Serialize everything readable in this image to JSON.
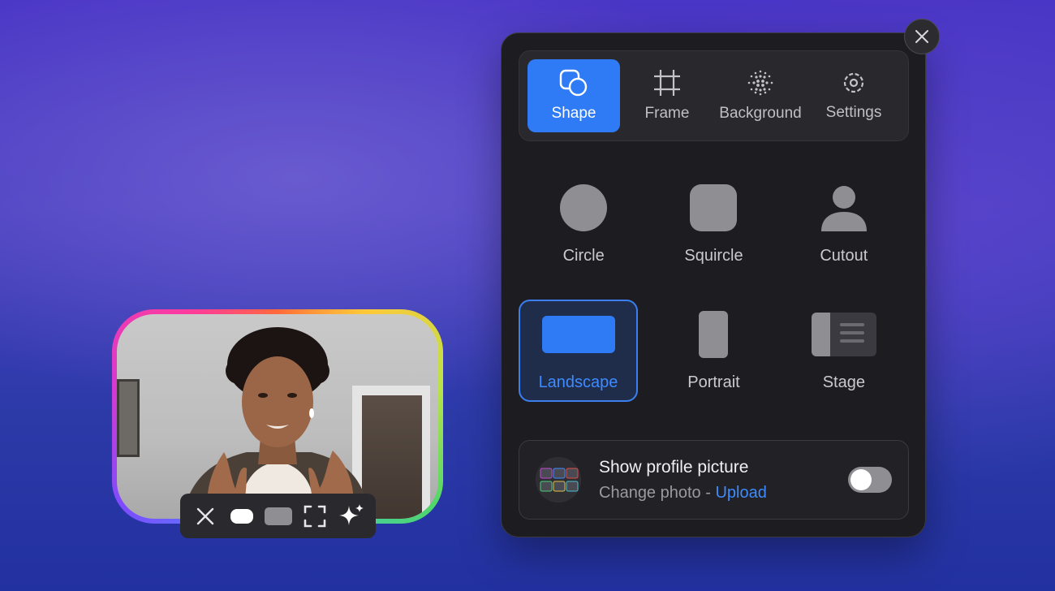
{
  "camera": {
    "toolbar": [
      {
        "name": "close-icon"
      },
      {
        "name": "pill-shape-icon"
      },
      {
        "name": "rectangle-shape-icon"
      },
      {
        "name": "fullscreen-icon"
      },
      {
        "name": "sparkle-icon"
      }
    ]
  },
  "panel": {
    "tabs": [
      {
        "label": "Shape",
        "icon": "shape-icon",
        "active": true
      },
      {
        "label": "Frame",
        "icon": "frame-icon",
        "active": false
      },
      {
        "label": "Background",
        "icon": "background-icon",
        "active": false
      },
      {
        "label": "Settings",
        "icon": "gear-icon",
        "active": false
      }
    ],
    "shapes": [
      {
        "label": "Circle",
        "icon": "circle-icon",
        "selected": false
      },
      {
        "label": "Squircle",
        "icon": "squircle-icon",
        "selected": false
      },
      {
        "label": "Cutout",
        "icon": "cutout-icon",
        "selected": false
      },
      {
        "label": "Landscape",
        "icon": "landscape-icon",
        "selected": true
      },
      {
        "label": "Portrait",
        "icon": "portrait-icon",
        "selected": false
      },
      {
        "label": "Stage",
        "icon": "stage-icon",
        "selected": false
      }
    ],
    "profile": {
      "title": "Show profile picture",
      "change_text": "Change photo -",
      "upload_label": "Upload",
      "toggle_on": false
    }
  },
  "colors": {
    "accent": "#2f7bf5",
    "panel_bg": "#1d1d21",
    "link": "#3d8bff"
  }
}
